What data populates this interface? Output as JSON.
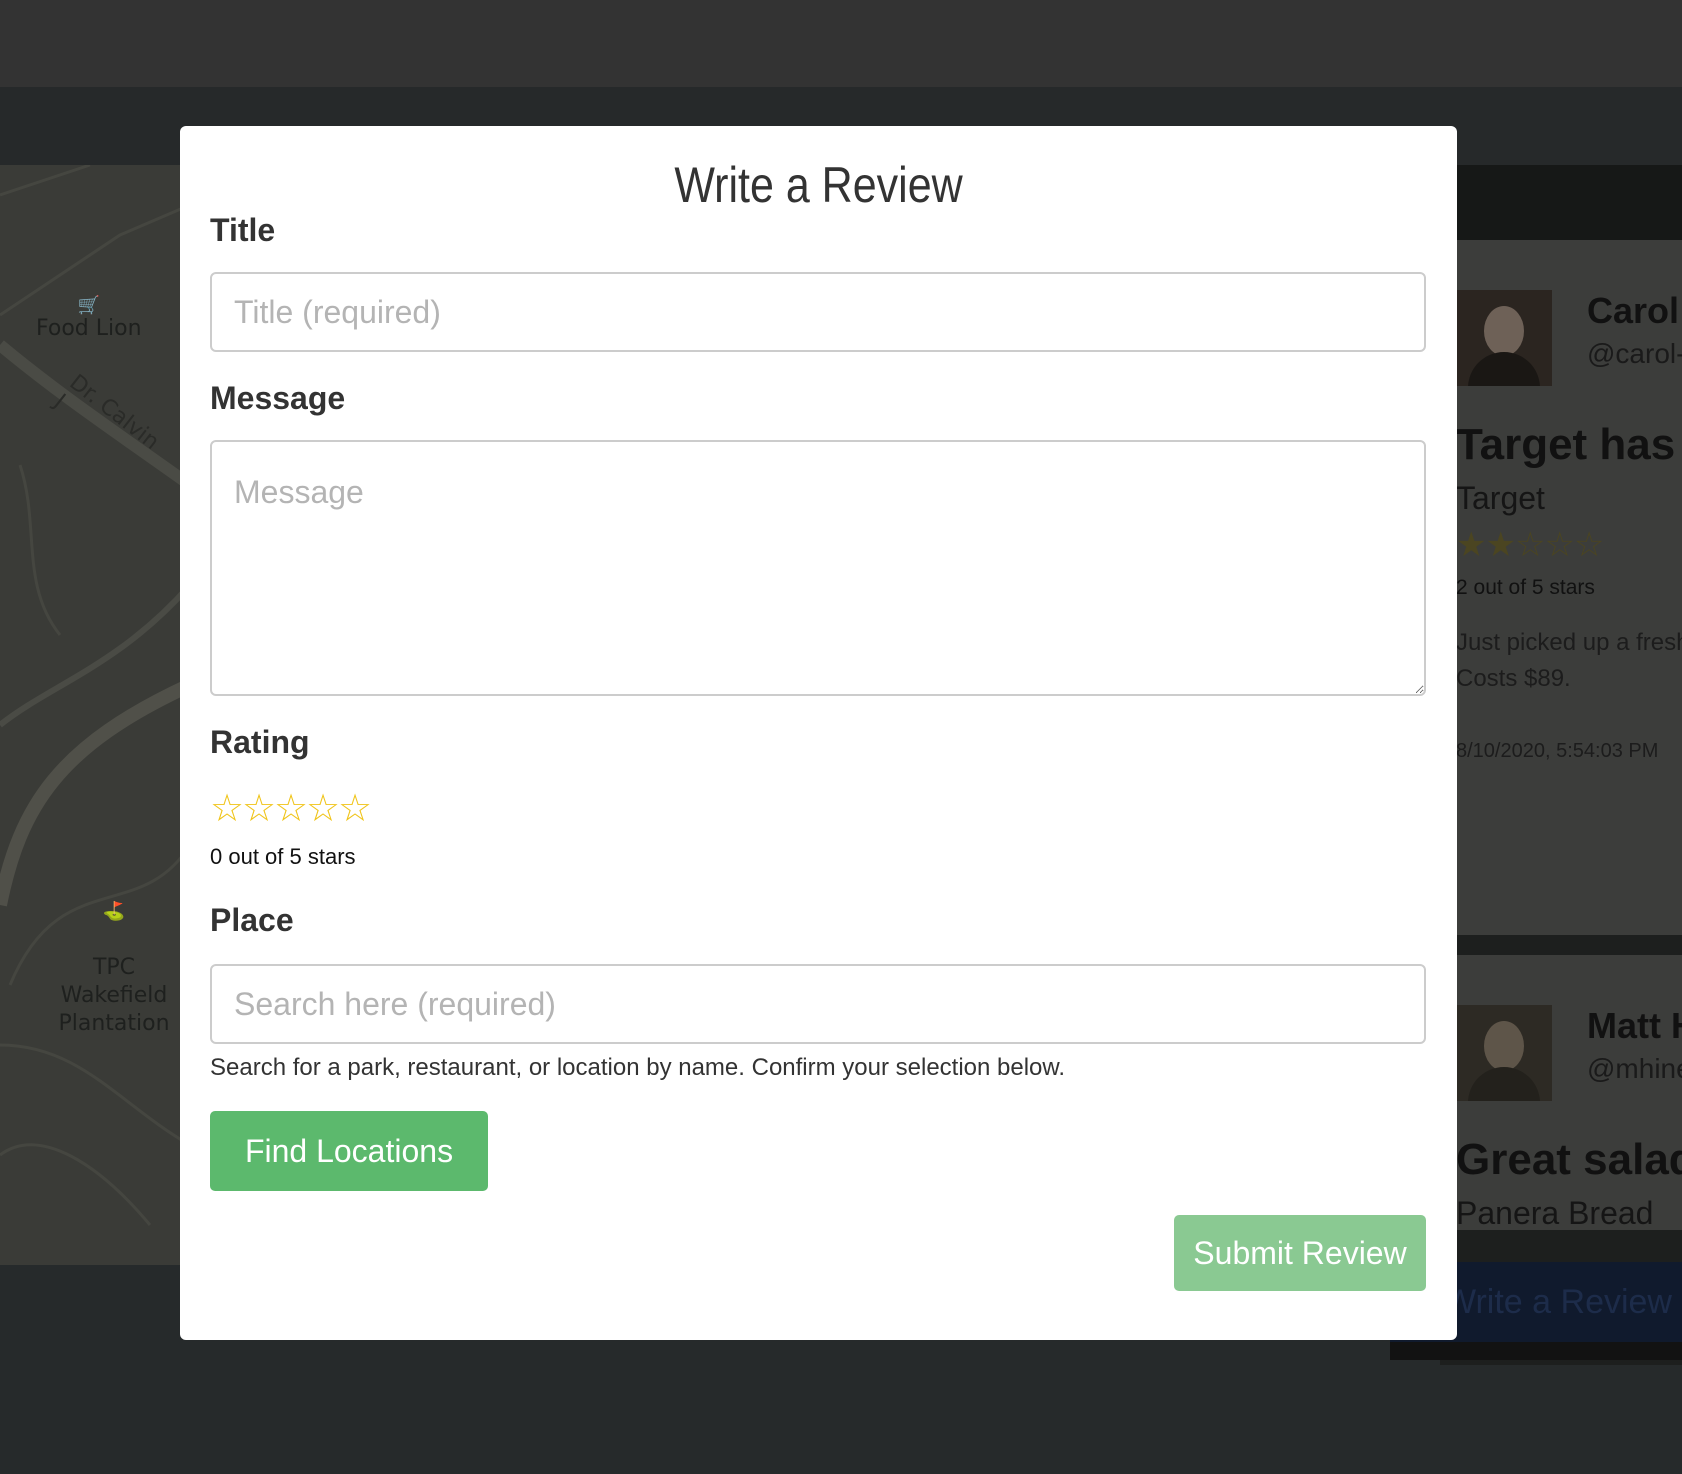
{
  "background": {
    "map": {
      "pois": [
        {
          "label": "Food Lion",
          "icon": "cart-icon"
        },
        {
          "label": "TPC Wakefield\nPlantation",
          "icon": "golf-icon"
        }
      ],
      "street": "Dr. Calvin J"
    },
    "feed": {
      "cards": [
        {
          "name": "Carol",
          "handle": "@carol-",
          "title": "Target has",
          "place": "Target",
          "stars": "★★☆☆☆",
          "rating": 2,
          "rating_text": "2 out of 5 stars",
          "text_line1": "Just picked up a fresh",
          "text_line2": "Costs $89.",
          "date": "8/10/2020, 5:54:03 PM"
        },
        {
          "name": "Matt H",
          "handle": "@mhine",
          "title": "Great salad",
          "place": "Panera Bread"
        }
      ],
      "write_button": "Write a Review"
    }
  },
  "modal": {
    "title": "Write a Review",
    "title_label": "Title",
    "title_placeholder": "Title (required)",
    "message_label": "Message",
    "message_placeholder": "Message",
    "rating_label": "Rating",
    "rating_stars": "☆☆☆☆☆",
    "rating": 0,
    "rating_text": "0 out of 5 stars",
    "place_label": "Place",
    "place_placeholder": "Search here (required)",
    "place_help": "Search for a park, restaurant, or location by name. Confirm your selection below.",
    "find_button": "Find Locations",
    "submit_button": "Submit Review"
  },
  "colors": {
    "accent_green": "#5cb96d",
    "submit_green": "#8ac992",
    "star_yellow": "#f0c419"
  }
}
